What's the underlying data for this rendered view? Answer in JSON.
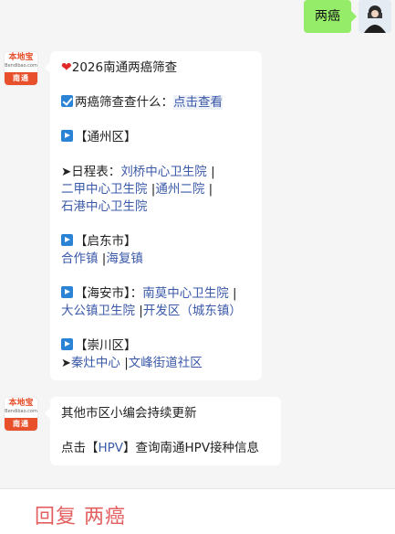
{
  "user_message": "两癌",
  "bot_avatar": {
    "site": "本地宝",
    "domain": "Bendibao.com",
    "city": "南通"
  },
  "message1": {
    "title": "2026南通两癌筛查",
    "check_prefix": "两癌筛查查什么：",
    "check_link": "点击查看",
    "tongzhou_header": "【通州区】",
    "schedule_prefix": "➤日程表：",
    "tongzhou_links": [
      "刘桥中心卫生院",
      "二甲中心卫生院",
      "通州二院",
      "石港中心卫生院"
    ],
    "qidong_header": "【启东市】",
    "qidong_links": [
      "合作镇",
      "海复镇"
    ],
    "haian_header": "【海安市】：",
    "haian_links": [
      "南莫中心卫生院",
      "大公镇卫生院",
      "开发区（城东镇）"
    ],
    "chongchuan_header": "【崇川区】",
    "chongchuan_links": [
      "秦灶中心",
      "文峰街道社区"
    ],
    "sep": "|"
  },
  "message2": {
    "line1": "其他市区小编会持续更新",
    "prefix": "点击【",
    "link": "HPV",
    "suffix": "】查询南通HPV接种信息"
  },
  "reply_bar": {
    "text": "回复 两癌"
  }
}
